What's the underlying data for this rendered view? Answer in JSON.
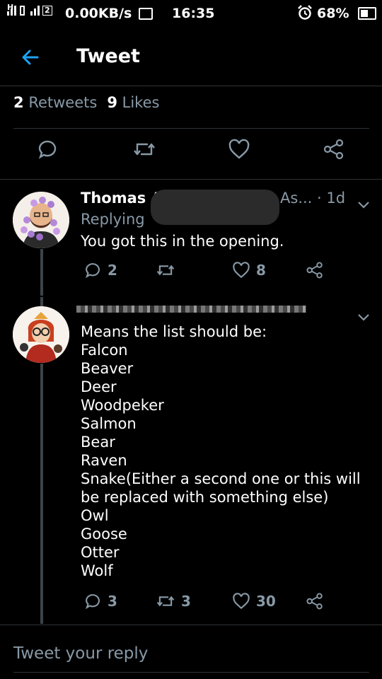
{
  "status_bar": {
    "network_label": "H",
    "sim2_label": "2",
    "speed": "0.00KB/s",
    "time": "16:35",
    "battery_percent": "68%",
    "battery_level": 0.68
  },
  "header": {
    "title": "Tweet"
  },
  "stats": {
    "retweets_count": "2",
    "retweets_label": "Retweets",
    "likes_count": "9",
    "likes_label": "Likes"
  },
  "main_tweet_actions": [
    "reply-icon",
    "retweet-icon",
    "like-icon",
    "share-icon"
  ],
  "replies": [
    {
      "author_visible": "Thomas A",
      "author_tail": "As... · 1d",
      "replying_prefix": "Replying",
      "text": "You got this in the opening.",
      "reply_count": "2",
      "retweet_count": "",
      "like_count": "8"
    },
    {
      "text": "Means the list should be:\nFalcon\nBeaver\nDeer\nWoodpeker\nSalmon\nBear\nRaven\nSnake(Either a second one or this will be replaced with something else)\nOwl\nGoose\nOtter\nWolf",
      "reply_count": "3",
      "retweet_count": "3",
      "like_count": "30"
    }
  ],
  "composer": {
    "placeholder": "Tweet your reply"
  },
  "colors": {
    "background": "#000000",
    "muted": "#8899a6",
    "accent": "#1da1f2",
    "divider": "#2f3336"
  }
}
